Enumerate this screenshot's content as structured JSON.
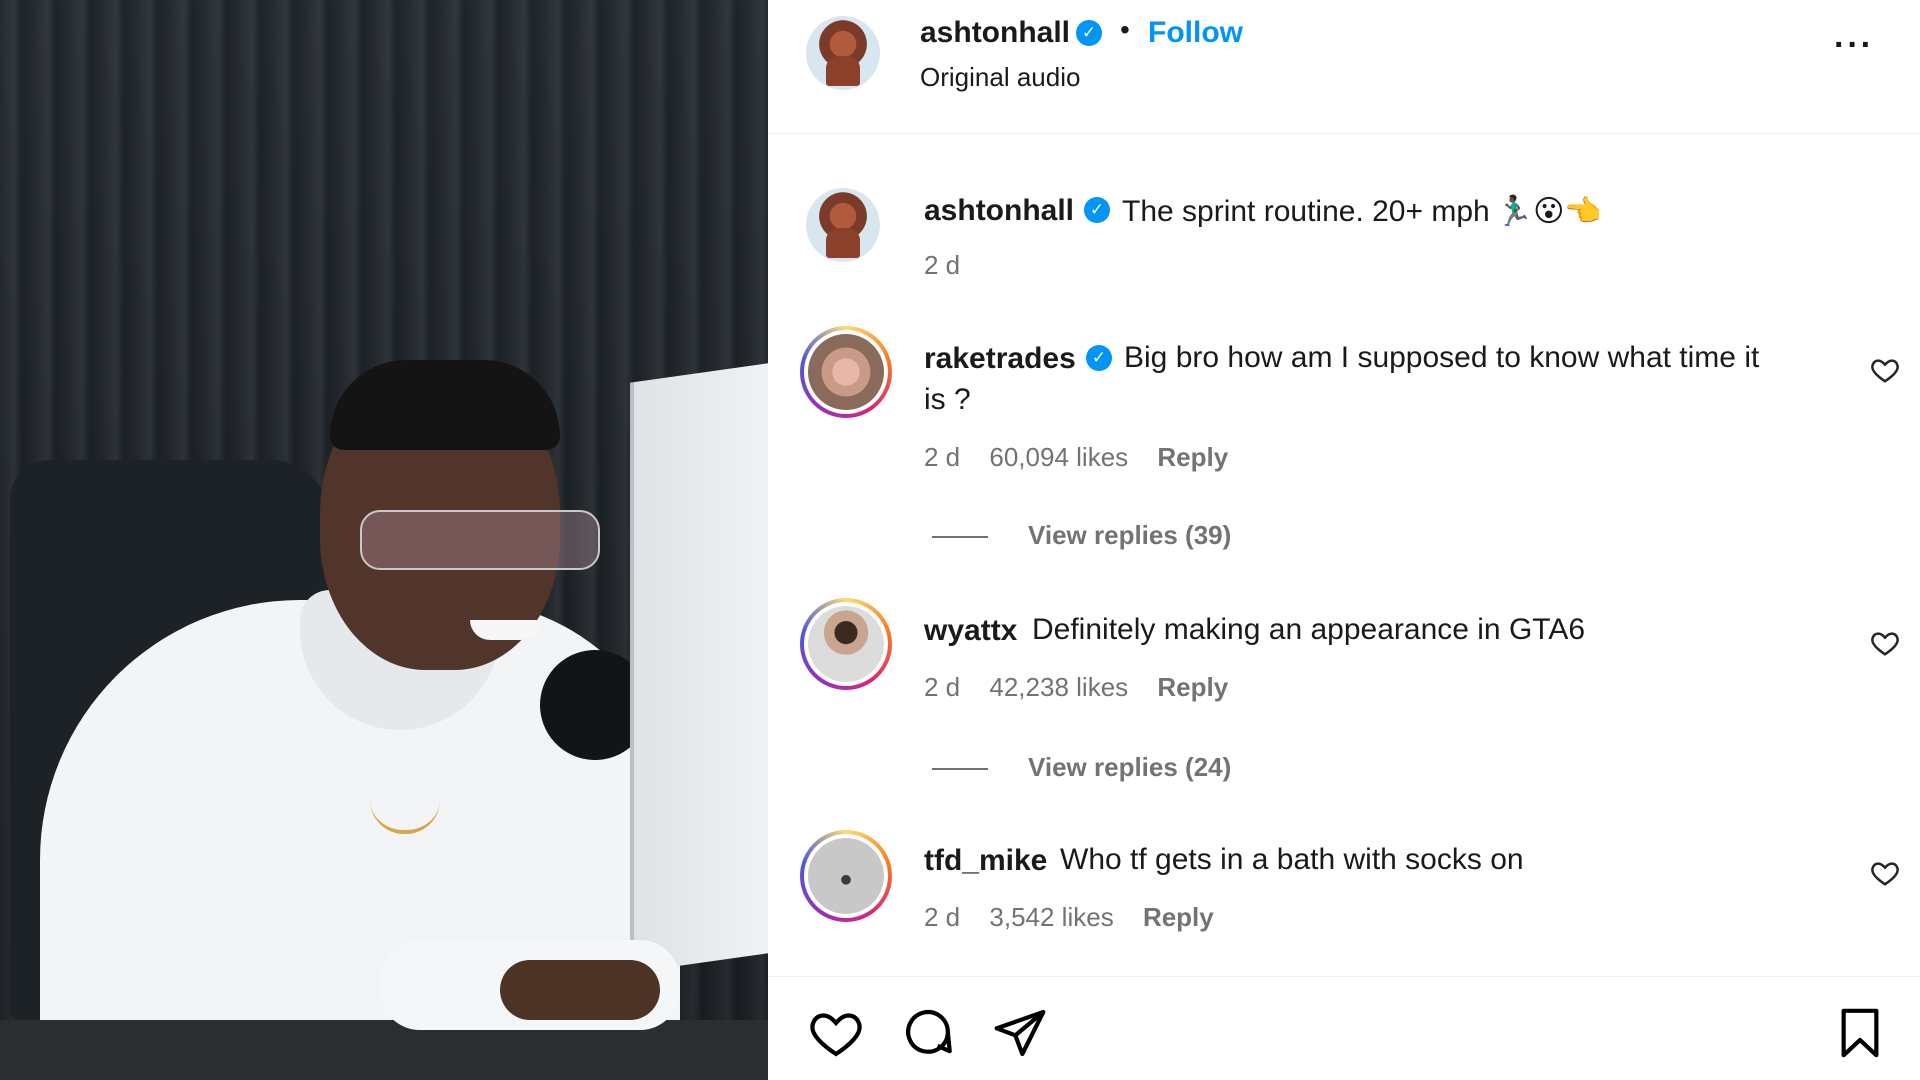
{
  "post": {
    "author": "ashtonhall",
    "verified_mark": "✓",
    "separator": "•",
    "follow_label": "Follow",
    "audio_label": "Original audio",
    "more_label": "···"
  },
  "caption": {
    "username": "ashtonhall",
    "text": "The sprint routine. 20+ mph",
    "emojis": "🏃🏿‍♂️😮👈",
    "time": "2 d"
  },
  "comments": [
    {
      "username": "raketrades",
      "verified": true,
      "text_line1": "Big bro how am I supposed to know what time it",
      "text_line2": "is ?",
      "time": "2 d",
      "likes": "60,094 likes",
      "reply_label": "Reply",
      "view_replies": "View replies (39)"
    },
    {
      "username": "wyattx",
      "verified": false,
      "text_line1": "Definitely making an appearance in GTA6",
      "time": "2 d",
      "likes": "42,238 likes",
      "reply_label": "Reply",
      "view_replies": "View replies (24)"
    },
    {
      "username": "tfd_mike",
      "verified": false,
      "text_line1": "Who tf gets in a bath with socks on",
      "time": "2 d",
      "likes": "3,542 likes",
      "reply_label": "Reply"
    }
  ],
  "icons": {
    "like": "heart-icon",
    "comment": "comment-bubble-icon",
    "share": "paper-plane-icon",
    "save": "bookmark-icon",
    "comment_like": "heart-outline-icon"
  },
  "colors": {
    "link_blue": "#0095f6",
    "meta_gray": "#737373"
  }
}
